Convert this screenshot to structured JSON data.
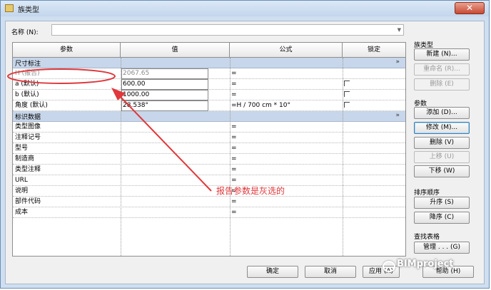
{
  "window": {
    "title": "族类型",
    "close_symbol": "✕"
  },
  "name_row": {
    "label": "名称 (N):",
    "value": ""
  },
  "table": {
    "headers": [
      "参数",
      "值",
      "公式",
      "锁定"
    ],
    "groups": [
      {
        "label": "尺寸标注",
        "toggle": "»",
        "rows": [
          {
            "param": "H (报告)",
            "value": "2067.65",
            "formula": "=",
            "lock": false
          },
          {
            "param": "a (默认)",
            "value": "600.00",
            "formula": "=",
            "lock": true
          },
          {
            "param": "b (默认)",
            "value": "1000.00",
            "formula": "=",
            "lock": true
          },
          {
            "param": "角度 (默认)",
            "value": "28.538°",
            "formula": "=H / 700 cm * 10°",
            "lock": true
          }
        ]
      },
      {
        "label": "标识数据",
        "toggle": "»",
        "rows": [
          {
            "param": "类型图像",
            "value": "",
            "formula": "=",
            "lock": false
          },
          {
            "param": "注释记号",
            "value": "",
            "formula": "=",
            "lock": false
          },
          {
            "param": "型号",
            "value": "",
            "formula": "=",
            "lock": false
          },
          {
            "param": "制造商",
            "value": "",
            "formula": "=",
            "lock": false
          },
          {
            "param": "类型注释",
            "value": "",
            "formula": "=",
            "lock": false
          },
          {
            "param": "URL",
            "value": "",
            "formula": "=",
            "lock": false
          },
          {
            "param": "说明",
            "value": "",
            "formula": "=",
            "lock": false
          },
          {
            "param": "部件代码",
            "value": "",
            "formula": "=",
            "lock": false
          },
          {
            "param": "成本",
            "value": "",
            "formula": "=",
            "lock": false
          }
        ]
      }
    ]
  },
  "sidebar": {
    "family_types": {
      "label": "族类型",
      "new": "新建 (N)...",
      "rename": "重命名 (R)...",
      "delete": "删除 (E)"
    },
    "parameters": {
      "label": "参数",
      "add": "添加 (D)...",
      "modify": "修改 (M)...",
      "delete": "删除 (V)",
      "move_up": "上移 (U)",
      "move_down": "下移 (W)"
    },
    "sort": {
      "label": "排序顺序",
      "asc": "升序 (S)",
      "desc": "降序 (C)"
    },
    "lookup": {
      "label": "查找表格",
      "manage": "管理 . . . (G)"
    }
  },
  "buttons": {
    "ok": "确定",
    "cancel": "取消",
    "apply": "应用 (A)",
    "help": "帮助 (H)"
  },
  "annotation": {
    "text": "报告参数是灰选的",
    "color": "#e0383c"
  },
  "watermark": {
    "text": "BIMproject"
  }
}
